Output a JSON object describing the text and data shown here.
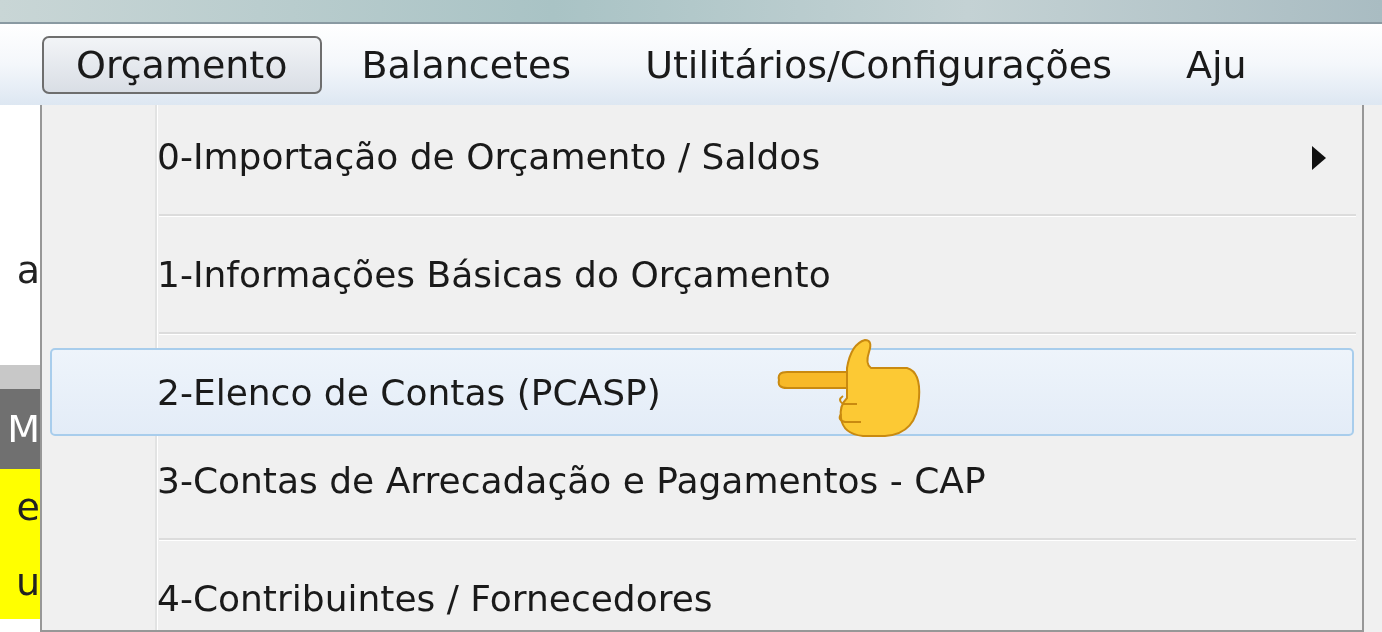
{
  "menu_bar": [
    {
      "label": "Orçamento",
      "selected": true
    },
    {
      "label": "Balancetes",
      "selected": false
    },
    {
      "label": "Utilitários/Configurações",
      "selected": false
    },
    {
      "label": "Aju",
      "selected": false
    }
  ],
  "background_fragments": [
    {
      "kind": "label",
      "text": "a"
    },
    {
      "kind": "header",
      "text": "M"
    },
    {
      "kind": "yellow",
      "text": "e"
    },
    {
      "kind": "yellow",
      "text": "u"
    }
  ],
  "dropdown": {
    "items": [
      {
        "kind": "item",
        "label": "0-Importação de Orçamento / Saldos",
        "submenu": true,
        "selected": false
      },
      {
        "kind": "separator"
      },
      {
        "kind": "item",
        "label": "1-Informações Básicas do Orçamento",
        "submenu": false,
        "selected": false
      },
      {
        "kind": "separator"
      },
      {
        "kind": "item",
        "label": "2-Elenco de Contas (PCASP)",
        "submenu": false,
        "selected": true
      },
      {
        "kind": "item",
        "label": "3-Contas de Arrecadação e Pagamentos - CAP",
        "submenu": false,
        "selected": false
      },
      {
        "kind": "separator"
      },
      {
        "kind": "item",
        "label": "4-Contribuintes / Fornecedores",
        "submenu": false,
        "selected": false
      }
    ]
  }
}
